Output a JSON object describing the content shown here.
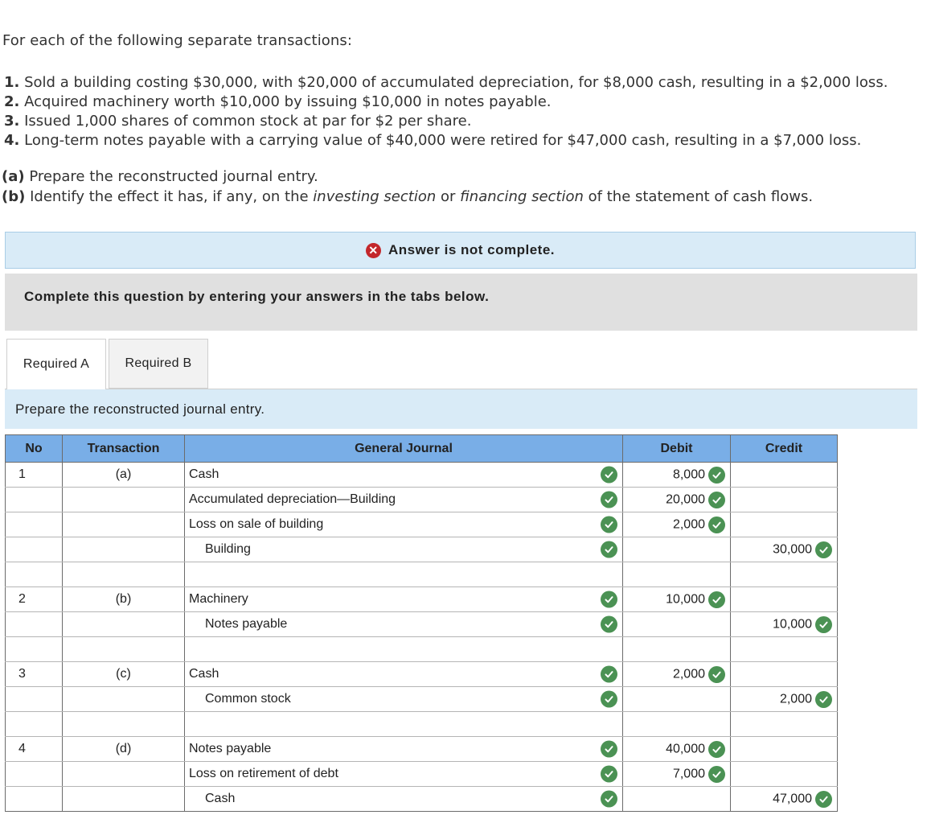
{
  "question": {
    "intro": "For each of the following separate transactions:",
    "transactions": [
      {
        "num": "1.",
        "text": "Sold a building costing $30,000, with $20,000 of accumulated depreciation, for $8,000 cash, resulting in a $2,000 loss."
      },
      {
        "num": "2.",
        "text": "Acquired machinery worth $10,000 by issuing $10,000 in notes payable."
      },
      {
        "num": "3.",
        "text": "Issued 1,000 shares of common stock at par for $2 per share."
      },
      {
        "num": "4.",
        "text": "Long-term notes payable with a carrying value of $40,000 were retired for $47,000 cash, resulting in a $7,000 loss."
      }
    ],
    "part_a_label": "(a)",
    "part_a_text": "Prepare the reconstructed journal entry.",
    "part_b_label": "(b)",
    "part_b_pre": "Identify the effect it has, if any, on the",
    "part_b_em1": "investing section",
    "part_b_mid": "or",
    "part_b_em2": "financing section",
    "part_b_post": "of the statement of cash flows."
  },
  "status_banner": "Answer is not complete.",
  "instruction": "Complete this question by entering your answers in the tabs below.",
  "tabs": [
    {
      "label": "Required A",
      "active": true
    },
    {
      "label": "Required B",
      "active": false
    }
  ],
  "tab_prompt": "Prepare the reconstructed journal entry.",
  "journal": {
    "headers": {
      "no": "No",
      "transaction": "Transaction",
      "general_journal": "General Journal",
      "debit": "Debit",
      "credit": "Credit"
    },
    "rows": [
      {
        "no": "1",
        "txn": "(a)",
        "account": "Cash",
        "indent": false,
        "debit": "8,000",
        "credit": "",
        "check": true
      },
      {
        "no": "",
        "txn": "",
        "account": "Accumulated depreciation—Building",
        "indent": false,
        "debit": "20,000",
        "credit": "",
        "check": true
      },
      {
        "no": "",
        "txn": "",
        "account": "Loss on sale of building",
        "indent": false,
        "debit": "2,000",
        "credit": "",
        "check": true
      },
      {
        "no": "",
        "txn": "",
        "account": "Building",
        "indent": true,
        "debit": "",
        "credit": "30,000",
        "check": true
      },
      {
        "no": "",
        "txn": "",
        "account": "",
        "indent": false,
        "debit": "",
        "credit": "",
        "check": false
      },
      {
        "no": "2",
        "txn": "(b)",
        "account": "Machinery",
        "indent": false,
        "debit": "10,000",
        "credit": "",
        "check": true
      },
      {
        "no": "",
        "txn": "",
        "account": "Notes payable",
        "indent": true,
        "debit": "",
        "credit": "10,000",
        "check": true
      },
      {
        "no": "",
        "txn": "",
        "account": "",
        "indent": false,
        "debit": "",
        "credit": "",
        "check": false
      },
      {
        "no": "3",
        "txn": "(c)",
        "account": "Cash",
        "indent": false,
        "debit": "2,000",
        "credit": "",
        "check": true
      },
      {
        "no": "",
        "txn": "",
        "account": "Common stock",
        "indent": true,
        "debit": "",
        "credit": "2,000",
        "check": true
      },
      {
        "no": "",
        "txn": "",
        "account": "",
        "indent": false,
        "debit": "",
        "credit": "",
        "check": false
      },
      {
        "no": "4",
        "txn": "(d)",
        "account": "Notes payable",
        "indent": false,
        "debit": "40,000",
        "credit": "",
        "check": true
      },
      {
        "no": "",
        "txn": "",
        "account": "Loss on retirement of debt",
        "indent": false,
        "debit": "7,000",
        "credit": "",
        "check": true
      },
      {
        "no": "",
        "txn": "",
        "account": "Cash",
        "indent": true,
        "debit": "",
        "credit": "47,000",
        "check": true
      }
    ]
  },
  "colors": {
    "correct": "#4b9254",
    "incorrect": "#c3272b",
    "header": "#79aee7",
    "banner": "#d9ebf7"
  }
}
